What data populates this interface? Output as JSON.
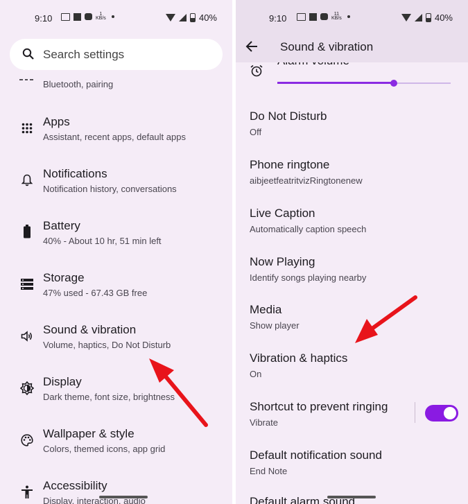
{
  "left": {
    "status": {
      "time": "9:10",
      "kb_top": "1",
      "kb_unit": "KB/s",
      "battery": "40%"
    },
    "search_placeholder": "Search settings",
    "partial_item": {
      "sub": "Bluetooth, pairing"
    },
    "items": [
      {
        "title": "Apps",
        "sub": "Assistant, recent apps, default apps",
        "icon": "apps-grid-icon"
      },
      {
        "title": "Notifications",
        "sub": "Notification history, conversations",
        "icon": "bell-icon"
      },
      {
        "title": "Battery",
        "sub": "40% - About 10 hr, 51 min left",
        "icon": "battery-icon"
      },
      {
        "title": "Storage",
        "sub": "47% used - 67.43 GB free",
        "icon": "storage-icon"
      },
      {
        "title": "Sound & vibration",
        "sub": "Volume, haptics, Do Not Disturb",
        "icon": "speaker-icon"
      },
      {
        "title": "Display",
        "sub": "Dark theme, font size, brightness",
        "icon": "brightness-icon"
      },
      {
        "title": "Wallpaper & style",
        "sub": "Colors, themed icons, app grid",
        "icon": "palette-icon"
      },
      {
        "title": "Accessibility",
        "sub": "Display, interaction, audio",
        "icon": "accessibility-icon"
      }
    ]
  },
  "right": {
    "status": {
      "time": "9:10",
      "kb_top": "11",
      "kb_unit": "KB/s",
      "battery": "40%"
    },
    "header_title": "Sound & vibration",
    "alarm_volume": {
      "label": "Alarm volume",
      "level": 0.67
    },
    "items": [
      {
        "title": "Do Not Disturb",
        "sub": "Off"
      },
      {
        "title": "Phone ringtone",
        "sub": "aibjeetfeatritvizRingtonenew"
      },
      {
        "title": "Live Caption",
        "sub": "Automatically caption speech"
      },
      {
        "title": "Now Playing",
        "sub": "Identify songs playing nearby"
      },
      {
        "title": "Media",
        "sub": "Show player"
      },
      {
        "title": "Vibration & haptics",
        "sub": "On"
      },
      {
        "title": "Shortcut to prevent ringing",
        "sub": "Vibrate",
        "toggle": true
      },
      {
        "title": "Default notification sound",
        "sub": "End Note"
      },
      {
        "title": "Default alarm sound",
        "sub": ""
      }
    ]
  },
  "colors": {
    "accent": "#8a1be2",
    "arrow": "#e8141b",
    "background": "#f5ecf7"
  }
}
